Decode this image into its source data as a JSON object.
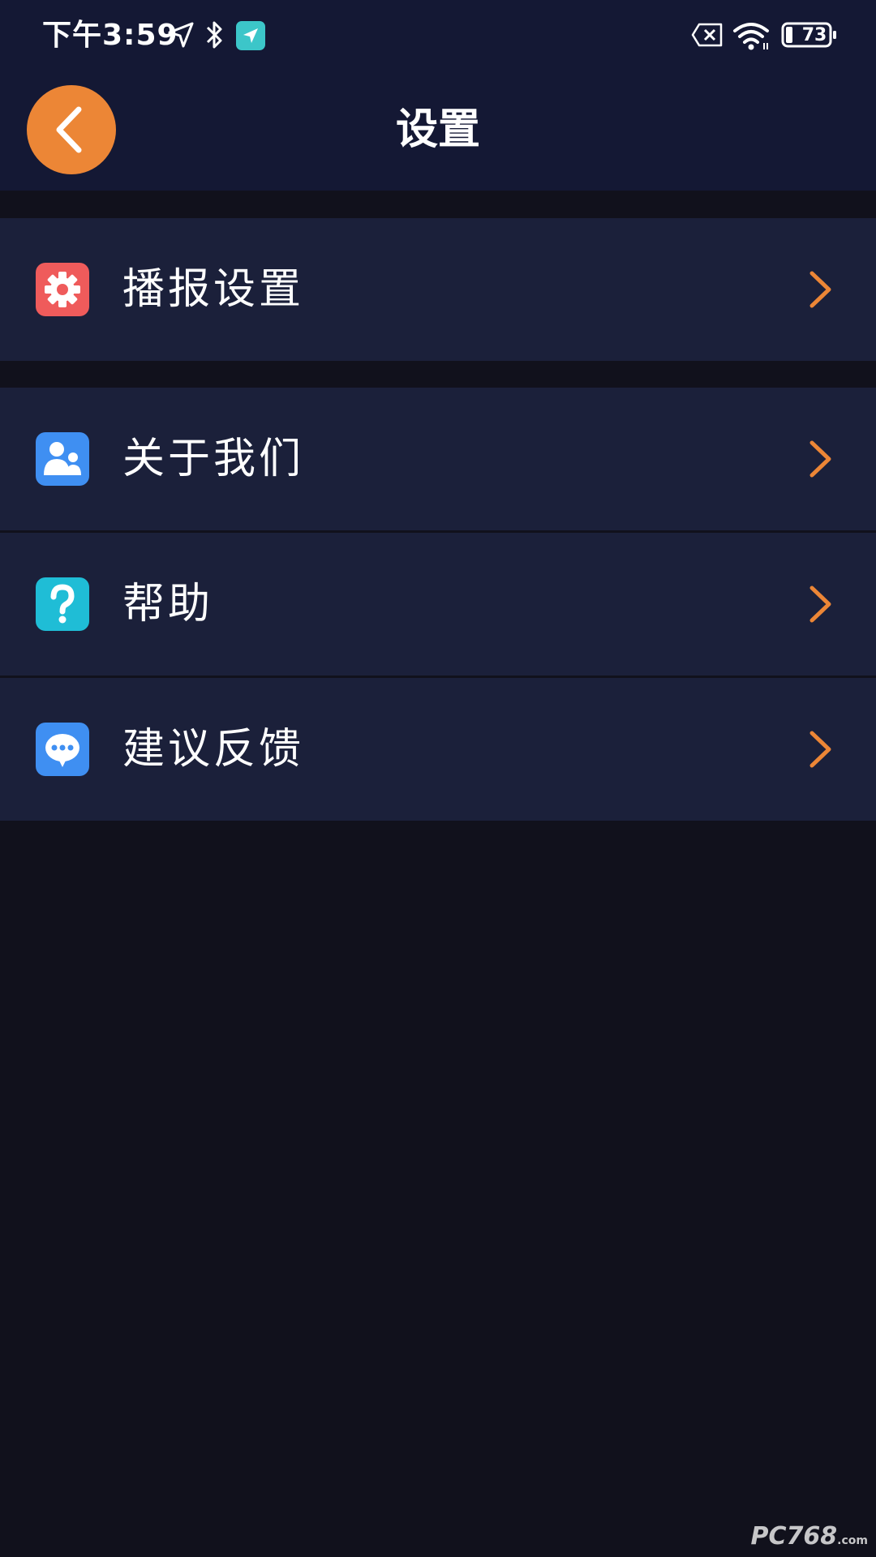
{
  "status_bar": {
    "time": "下午3:59",
    "battery_level": "73"
  },
  "header": {
    "title": "设置"
  },
  "items": [
    {
      "label": "播报设置",
      "icon": "gear-icon",
      "color": "#ef5b5b"
    },
    {
      "label": "关于我们",
      "icon": "users-icon",
      "color": "#3f8ff2"
    },
    {
      "label": "帮助",
      "icon": "question-icon",
      "color": "#1fbdd6"
    },
    {
      "label": "建议反馈",
      "icon": "chat-bubble-icon",
      "color": "#3f8ff2"
    }
  ],
  "watermark": {
    "text": "PC768",
    "sub": ".com"
  },
  "colors": {
    "accent": "#ec8636",
    "background": "#11111c",
    "header_bg": "#141834",
    "item_bg": "#1b203a"
  }
}
